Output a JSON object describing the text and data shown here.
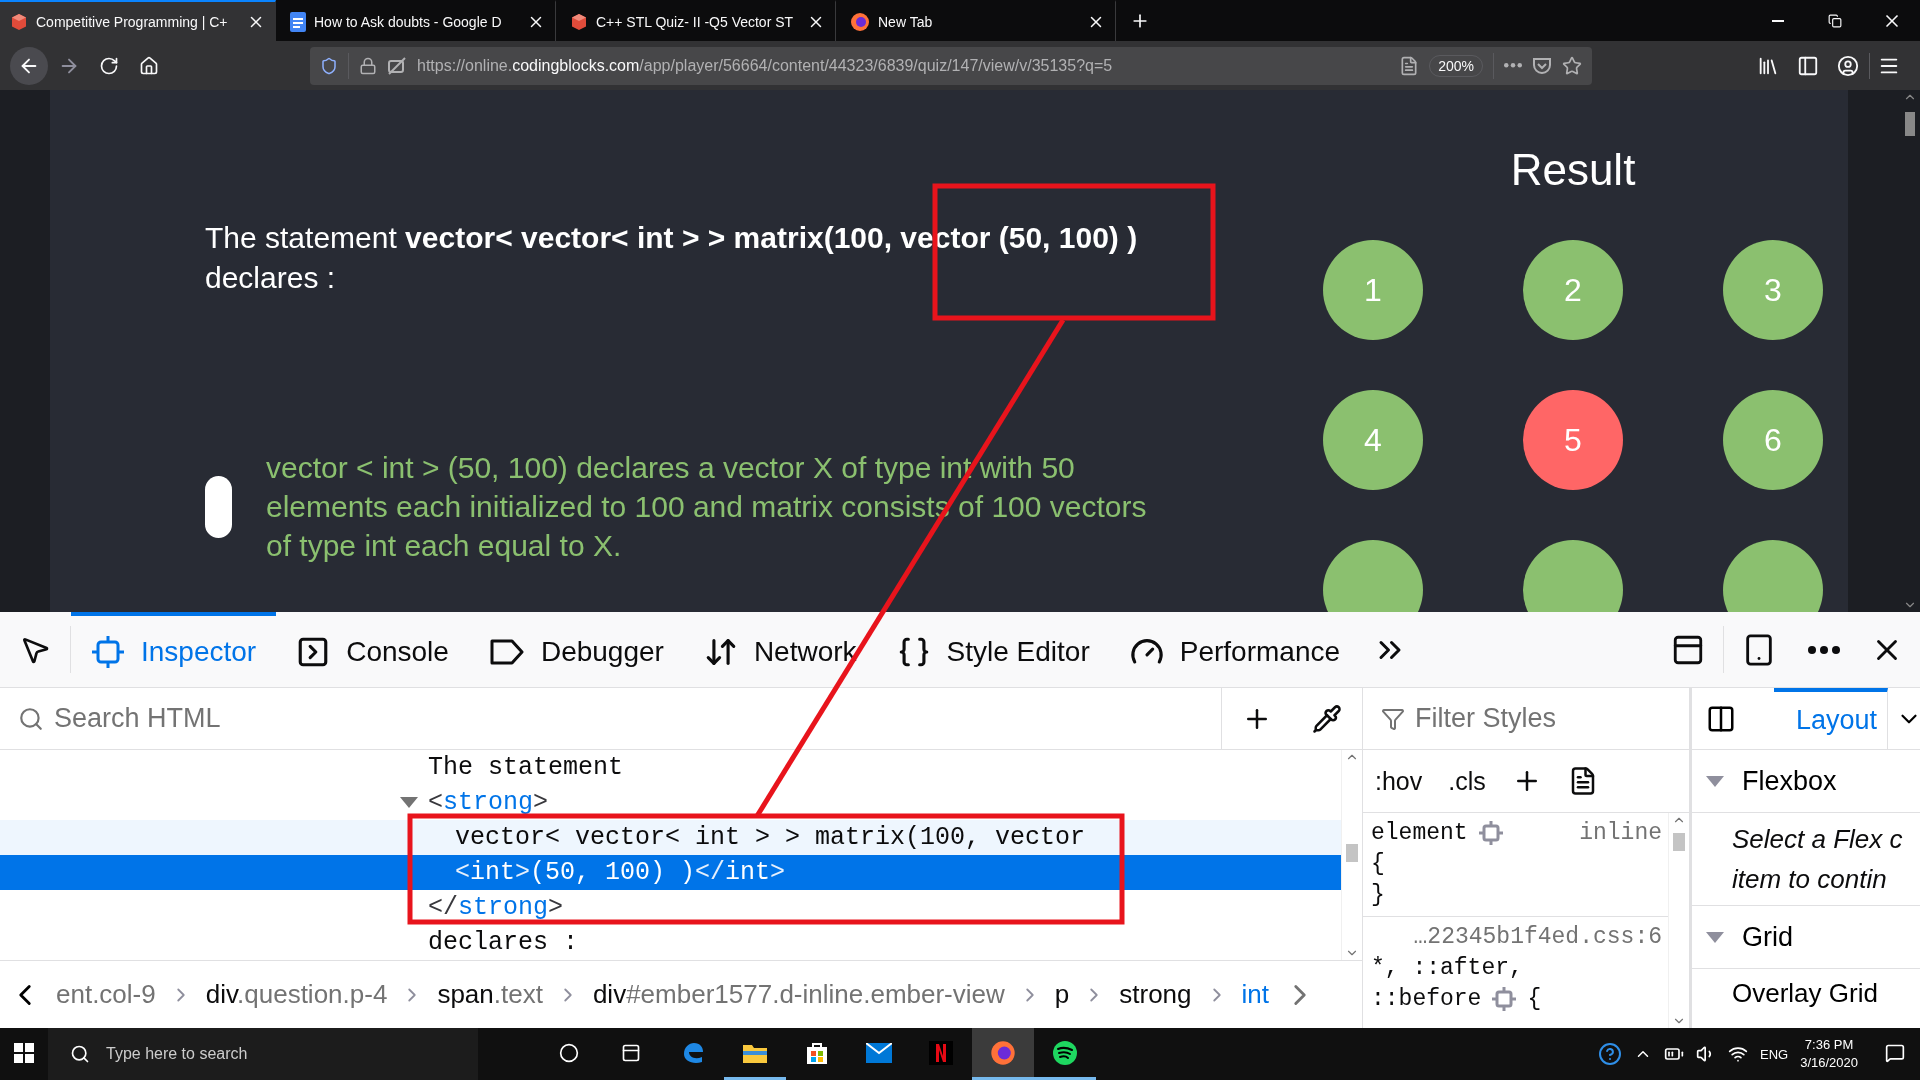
{
  "browser_tabs": [
    {
      "title": "Competitive Programming | C+",
      "selected": true
    },
    {
      "title": "How to Ask doubts - Google D",
      "selected": false
    },
    {
      "title": "C++ STL Quiz- II -Q5 Vector ST",
      "selected": false
    },
    {
      "title": "New Tab",
      "selected": false
    }
  ],
  "address_bar": {
    "url_prefix": "https://online.",
    "url_domain": "codingblocks.com",
    "url_path": "/app/player/56664/content/44323/6839/quiz/147/view/v/35135?q=5",
    "zoom": "200%"
  },
  "page": {
    "question": "The statement **vector< vector< int > > matrix(100, vector (50, 100) )** declares :",
    "option": "vector < int > (50, 100) declares a vector X of type int with 50 elements each initialized to 100 and matrix consists of 100 vectors of type int each equal to X.",
    "result": {
      "title": "Result",
      "items": [
        {
          "label": "1",
          "color": "#8bc06f"
        },
        {
          "label": "2",
          "color": "#8bc06f"
        },
        {
          "label": "3",
          "color": "#8bc06f"
        },
        {
          "label": "4",
          "color": "#8bc06f"
        },
        {
          "label": "5",
          "color": "#ff6666"
        },
        {
          "label": "6",
          "color": "#8bc06f"
        },
        {
          "color": "#8bc06f"
        },
        {
          "color": "#8bc06f"
        },
        {
          "color": "#8bc06f"
        }
      ]
    }
  },
  "devtools": {
    "tabs": [
      {
        "label": "Inspector",
        "selected": true
      },
      {
        "label": "Console",
        "selected": false
      },
      {
        "label": "Debugger",
        "selected": false
      },
      {
        "label": "Network",
        "selected": false
      },
      {
        "label": "Style Editor",
        "selected": false
      },
      {
        "label": "Performance",
        "selected": false
      }
    ],
    "html_search": {
      "placeholder": "Search HTML"
    },
    "html_tree": [
      {
        "selected": false,
        "hovered": false,
        "segments": [
          {
            "kind": "text",
            "text": "The statement"
          }
        ]
      },
      {
        "selected": false,
        "hovered": false,
        "expanded": true,
        "segments": [
          {
            "kind": "punct",
            "text": "<"
          },
          {
            "kind": "tag",
            "text": "strong"
          },
          {
            "kind": "punct",
            "text": ">"
          }
        ],
        "children": [
          {
            "selected": false,
            "hovered": true,
            "segments": [
              {
                "kind": "text",
                "text": "vector< vector< int > > matrix(100, vector"
              }
            ]
          },
          {
            "selected": true,
            "hovered": false,
            "segments": [
              {
                "kind": "punct",
                "text": "<"
              },
              {
                "kind": "tag",
                "text": "int"
              },
              {
                "kind": "punct",
                "text": ">"
              },
              {
                "kind": "text",
                "text": "(50, 100) )"
              },
              {
                "kind": "punct",
                "text": "</"
              },
              {
                "kind": "tag",
                "text": "int"
              },
              {
                "kind": "punct",
                "text": ">"
              }
            ]
          }
        ],
        "closing": [
          {
            "kind": "punct",
            "text": "</"
          },
          {
            "kind": "tag",
            "text": "strong"
          },
          {
            "kind": "punct",
            "text": ">"
          }
        ]
      },
      {
        "selected": false,
        "hovered": false,
        "segments": [
          {
            "kind": "text",
            "text": "declares :"
          }
        ]
      }
    ],
    "breadcrumbs": [
      {
        "rest": "ent.col-9",
        "selected": false
      },
      {
        "tag": "div",
        "rest": ".question.p-4",
        "selected": false
      },
      {
        "tag": "span",
        "rest": ".text",
        "selected": false
      },
      {
        "tag": "div",
        "rest": "#ember1577.d-inline.ember-view",
        "selected": false
      },
      {
        "tag": "p",
        "selected": false
      },
      {
        "tag": "strong",
        "selected": false
      },
      {
        "tag": "int",
        "selected": true
      }
    ],
    "styles": {
      "placeholder": "Filter Styles",
      "toggles": [
        ":hov",
        ".cls"
      ],
      "rules": [
        {
          "kind": "element",
          "selector": [
            "element"
          ],
          "source": "inline",
          "open": "{",
          "close": "}"
        },
        {
          "kind": "stylesheet",
          "source": "…22345b1f4ed.css:6",
          "selector": [
            "*, ::after,",
            "::before"
          ],
          "open": "{"
        }
      ]
    },
    "layout": {
      "tab": "Layout",
      "sections": [
        {
          "title": "Flexbox",
          "expanded": true,
          "message": [
            "Select a Flex c",
            "item to contin"
          ]
        },
        {
          "title": "Grid",
          "expanded": true,
          "subheading": "Overlay Grid"
        }
      ]
    }
  },
  "taskbar": {
    "search_placeholder": "Type here to search",
    "apps": [
      {
        "running": false,
        "active": false
      },
      {
        "running": true,
        "active": false
      },
      {
        "running": false,
        "active": false
      },
      {
        "running": false,
        "active": false
      },
      {
        "running": false,
        "active": false
      },
      {
        "running": true,
        "active": true
      },
      {
        "running": true,
        "active": false
      }
    ],
    "language": "ENG",
    "time": "7:36 PM",
    "date": "3/16/2020"
  }
}
